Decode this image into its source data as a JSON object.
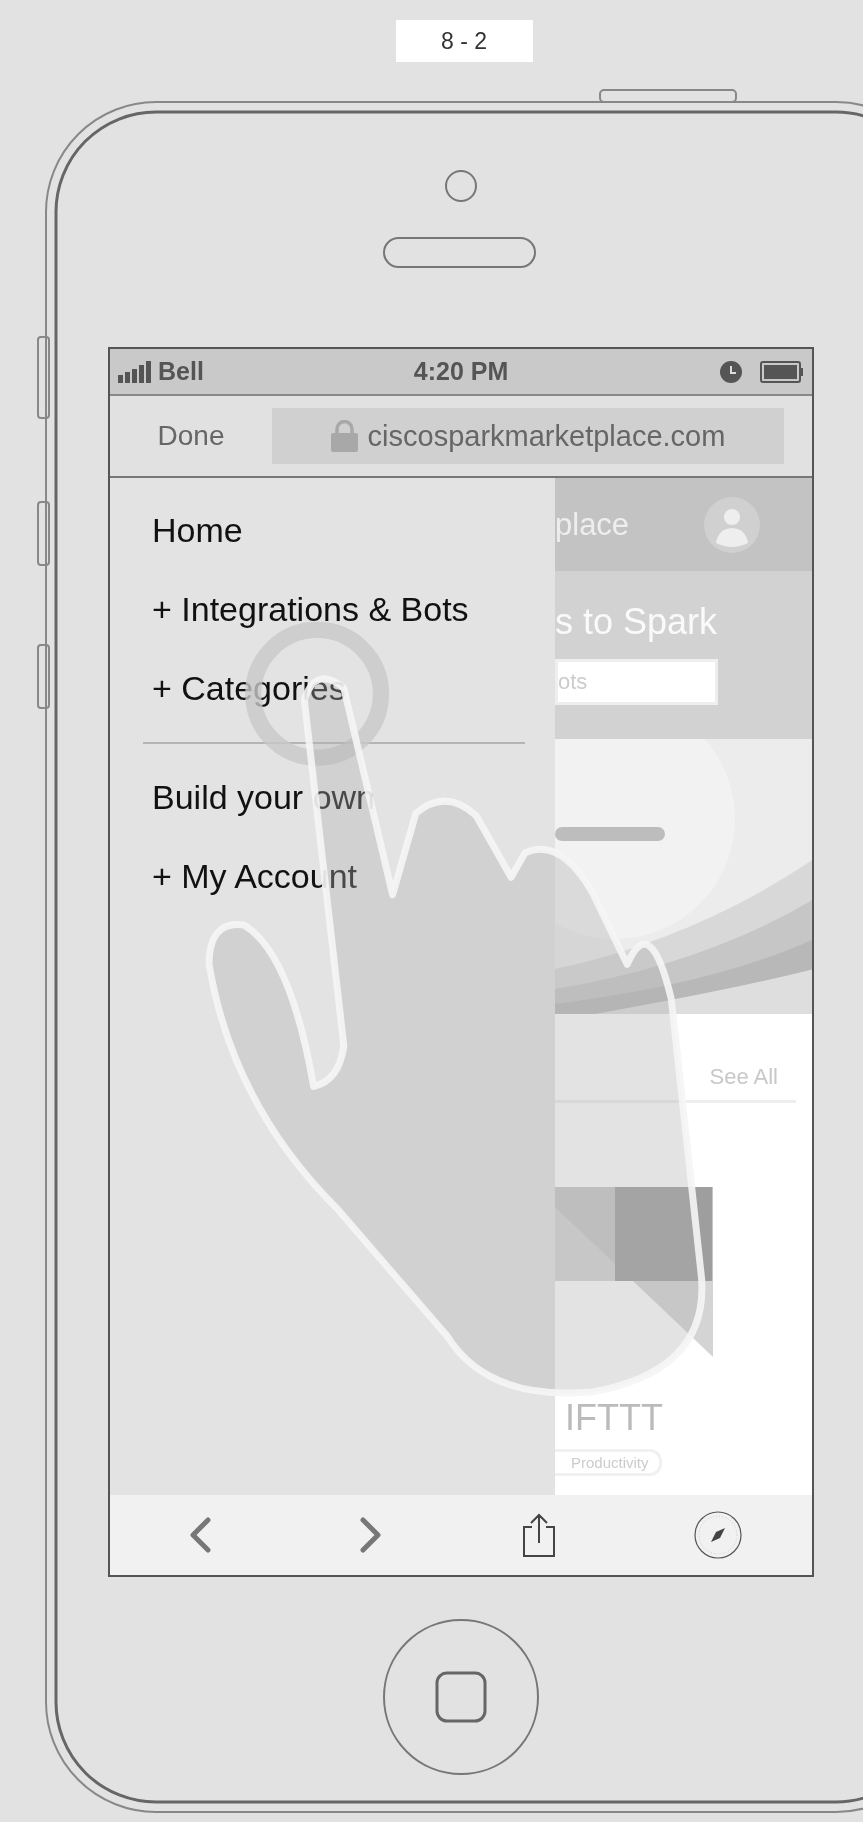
{
  "label": "8 - 2",
  "status_bar": {
    "carrier": "Bell",
    "time": "4:20 PM"
  },
  "browser_bar": {
    "done": "Done",
    "url": "ciscosparkmarketplace.com"
  },
  "drawer": {
    "items": [
      {
        "kind": "link",
        "label": "Home"
      },
      {
        "kind": "link",
        "label": "+ Integrations & Bots"
      },
      {
        "kind": "link",
        "label": "+ Categories"
      },
      {
        "kind": "divider"
      },
      {
        "kind": "link",
        "label": "Build your own"
      },
      {
        "kind": "link",
        "label": "+ My Account"
      }
    ]
  },
  "page": {
    "header_title": "place",
    "hero_title": "s to Spark",
    "search": {
      "placeholder": "ots"
    },
    "see_all": "See All",
    "app": {
      "name": "IFTTT",
      "tag": "Productivity"
    }
  }
}
